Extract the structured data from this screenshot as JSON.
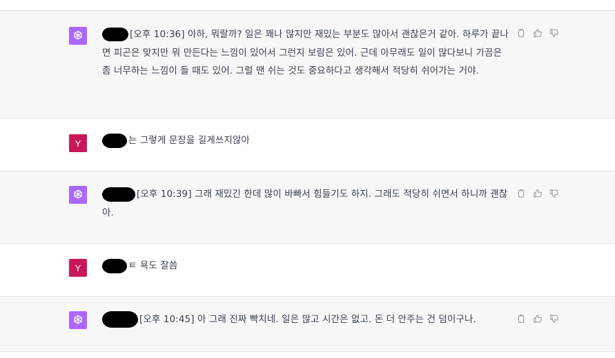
{
  "messages": [
    {
      "role": "assistant",
      "text": "[오후 10:36] 아하, 뭐랄까? 일은 꽤나 많지만 재밌는 부분도 많아서 괜찮은거 같아. 하루가 끝나면 피곤은 맞지만 뭐 만든다는 느낌이 있어서 그런지 보람은 있어. 근데 아무래도 일이 많다보니 가끔은 좀 너무하는 느낌이 들 때도 있어. 그럴 땐 쉬는 것도 중요하다고 생각해서 적당히 쉬어가는 거야."
    },
    {
      "role": "user",
      "avatar_letter": "Y",
      "text": "는 그렇게 문장을 길게쓰지않아"
    },
    {
      "role": "assistant",
      "text": "[오후 10:39] 그래 재밌긴 한데 많이 바빠서 힘들기도 하지. 그래도 적당히 쉬면서 하니까 괜찮아."
    },
    {
      "role": "user",
      "avatar_letter": "Y",
      "text": "ㅌ 욕도 잘씀"
    },
    {
      "role": "assistant",
      "text": "[오후 10:45] 아 그래 진짜 빡치네. 일은 많고 시간은 없고. 돈 더 안주는 건 덤이구나."
    }
  ],
  "icons": {
    "copy": "copy-icon",
    "like": "thumbs-up-icon",
    "dislike": "thumbs-down-icon",
    "assistant_avatar": "openai-logo-icon"
  },
  "colors": {
    "assistant_bg": "#f7f7f8",
    "assistant_avatar": "#ab68ff",
    "user_avatar": "#c8185a"
  }
}
